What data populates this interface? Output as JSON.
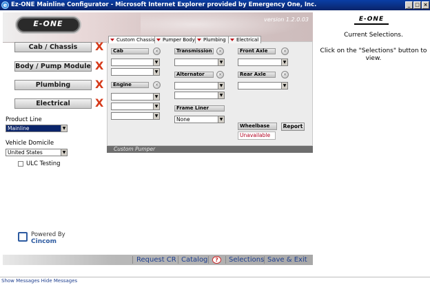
{
  "window": {
    "title": "Ez-ONE Mainline Configurator - Microsoft Internet Explorer provided by Emergency One, Inc.",
    "minimize": "_",
    "restore": "□",
    "close": "×"
  },
  "banner": {
    "logo_text": "E-ONE",
    "version": "version 1.2.0.03"
  },
  "nav": {
    "items": [
      {
        "label": "Cab / Chassis",
        "mark": "X"
      },
      {
        "label": "Body / Pump Module",
        "mark": "X"
      },
      {
        "label": "Plumbing",
        "mark": "X"
      },
      {
        "label": "Electrical",
        "mark": "X"
      }
    ]
  },
  "sidebar": {
    "product_line_label": "Product Line",
    "product_line_value": "Mainline",
    "domicile_label": "Vehicle Domicile",
    "domicile_value": "United States",
    "ulc_label": "ULC Testing"
  },
  "tabs": [
    {
      "label": "Custom Chassis"
    },
    {
      "label": "Pumper Body"
    },
    {
      "label": "Plumbing"
    },
    {
      "label": "Electrical"
    }
  ],
  "form": {
    "cab_label": "Cab",
    "engine_label": "Engine",
    "transmission_label": "Transmission",
    "alternator_label": "Alternator",
    "frame_liner_label": "Frame Liner",
    "frame_liner_value": "None",
    "front_axle_label": "Front Axle",
    "rear_axle_label": "Rear Axle",
    "wheelbase_label": "Wheelbase",
    "report_label": "Report",
    "wheelbase_value": "Unavailable",
    "circle_glyph": "×",
    "dropdown_arrow": "▼"
  },
  "footer_panel": {
    "text": "Custom Pumper"
  },
  "bottom_bar": {
    "request_cr": "Request CR",
    "catalog": "Catalog",
    "help": "?",
    "selections": "Selections",
    "save_exit": "Save & Exit"
  },
  "right_panel": {
    "logo_text": "E-ONE",
    "current": "Current Selections.",
    "hint": "Click on the \"Selections\" button to view."
  },
  "powered": {
    "line1": "Powered By",
    "line2": "Cincom"
  },
  "status": {
    "text": "Show Messages Hide Messages"
  }
}
